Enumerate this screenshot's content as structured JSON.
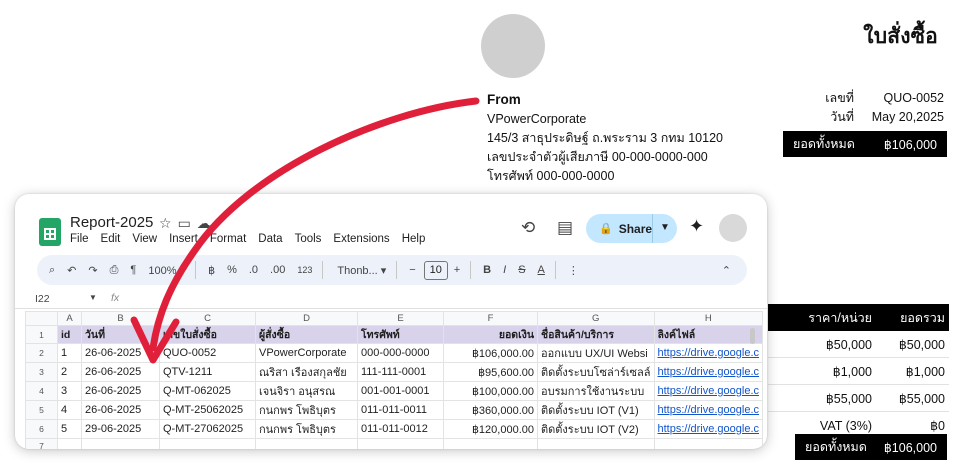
{
  "document": {
    "title": "ใบสั่งซื้อ",
    "from_label": "From",
    "company": "VPowerCorporate",
    "address": "145/3  สาธุประดิษฐ์ ถ.พระราม 3 กทม 10120",
    "tax_id": "เลขประจำตัวผู้เสียภาษี 00-000-0000-000",
    "phone": "โทรศัพท์ 000-000-0000",
    "meta": {
      "number_label": "เลขที่",
      "number_value": "QUO-0052",
      "date_label": "วันที่",
      "date_value": "May 20,2025"
    },
    "total_top": {
      "label": "ยอดทั้งหมด",
      "value": "฿106,000"
    },
    "items": {
      "header": {
        "unit_price": "ราคา/หน่วย",
        "amount": "ยอดรวม"
      },
      "rows": [
        {
          "unit_price": "฿50,000",
          "amount": "฿50,000"
        },
        {
          "unit_price": "฿1,000",
          "amount": "฿1,000"
        },
        {
          "unit_price": "฿55,000",
          "amount": "฿55,000"
        },
        {
          "unit_price": "VAT (3%)",
          "amount": "฿0"
        }
      ]
    },
    "total_bottom": {
      "label": "ยอดทั้งหมด",
      "value": "฿106,000"
    }
  },
  "sheets": {
    "doc_name": "Report-2025",
    "menu": [
      "File",
      "Edit",
      "View",
      "Insert",
      "Format",
      "Data",
      "Tools",
      "Extensions",
      "Help"
    ],
    "share_label": "Share",
    "toolbar": {
      "zoom": "100%",
      "font": "Thonb...",
      "font_size": "10"
    },
    "cell_ref": "I22",
    "fx": "fx",
    "columns": [
      "A",
      "B",
      "C",
      "D",
      "E",
      "F",
      "G",
      "H"
    ],
    "header_row": [
      "id",
      "วันที่",
      "เลขใบสั่งซื้อ",
      "ผู้สั่งซื้อ",
      "โทรศัพท์",
      "ยอดเงิน",
      "ชื่อสินค้า/บริการ",
      "ลิงค์ไฟล์"
    ],
    "rows": [
      [
        "1",
        "26-06-2025",
        "QUO-0052",
        "VPowerCorporate",
        "000-000-0000",
        "฿106,000.00",
        "ออกแบบ UX/UI  Websi",
        "https://drive.google.c"
      ],
      [
        "2",
        "26-06-2025",
        "QTV-1211",
        "ณริสา เรืองสกุลชัย",
        "111-111-0001",
        "฿95,600.00",
        "ติดตั้งระบบโซล่าร์เซลล์",
        "https://drive.google.c"
      ],
      [
        "3",
        "26-06-2025",
        "Q-MT-062025",
        "เจนจิรา อนุสรณ",
        "001-001-0001",
        "฿100,000.00",
        "อบรมการใช้งานระบบ",
        "https://drive.google.c"
      ],
      [
        "4",
        "26-06-2025",
        "Q-MT-25062025",
        "กนกพร โพธิบุตร",
        "011-011-0011",
        "฿360,000.00",
        "ติดตั้งระบบ IOT (V1)",
        "https://drive.google.c"
      ],
      [
        "5",
        "29-06-2025",
        "Q-MT-27062025",
        "กนกพร โพธิบุตร",
        "011-011-0012",
        "฿120,000.00",
        "ติดตั้งระบบ IOT (V2)",
        "https://drive.google.c"
      ]
    ],
    "row_numbers": [
      "1",
      "2",
      "3",
      "4",
      "5",
      "6",
      "7"
    ]
  },
  "colors": {
    "arrow": "#e0203a",
    "header_fill": "#d8d2eb",
    "share_bg": "#c2e7ff",
    "sheets_green": "#23a566"
  }
}
